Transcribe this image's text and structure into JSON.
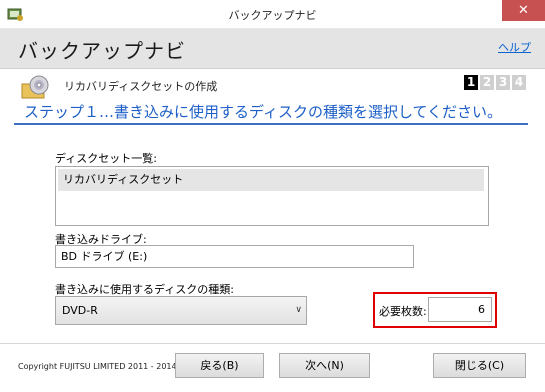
{
  "window": {
    "title": "バックアップナビ",
    "close_glyph": "✕"
  },
  "header": {
    "title": "バックアップナビ",
    "help_label": "ヘルプ"
  },
  "section": {
    "title": "リカバリディスクセットの作成",
    "steps": [
      "1",
      "2",
      "3",
      "4"
    ],
    "active_step": "1",
    "heading": "ステップ１…書き込みに使用するディスクの種類を選択してください。"
  },
  "disc_set_list": {
    "label": "ディスクセット一覧:",
    "items": [
      "リカバリディスクセット"
    ]
  },
  "write_drive": {
    "label": "書き込みドライブ:",
    "value": "BD ドライブ (E:)"
  },
  "disc_type": {
    "label": "書き込みに使用するディスクの種類:",
    "selected": "DVD-R"
  },
  "required_count": {
    "label": "必要枚数:",
    "value": "6"
  },
  "footer": {
    "copyright": "Copyright FUJITSU LIMITED 2011 - 2014",
    "back_label": "戻る(B)",
    "next_label": "次へ(N)",
    "close_label": "閉じる(C)"
  },
  "colors": {
    "accent": "#1d5fc7",
    "highlight_frame": "#e00000",
    "close_button": "#c75050"
  },
  "icons": {
    "app": "backup-navi-app-icon",
    "section": "disc-folder-icon",
    "dropdown": "chevron-down-icon"
  }
}
